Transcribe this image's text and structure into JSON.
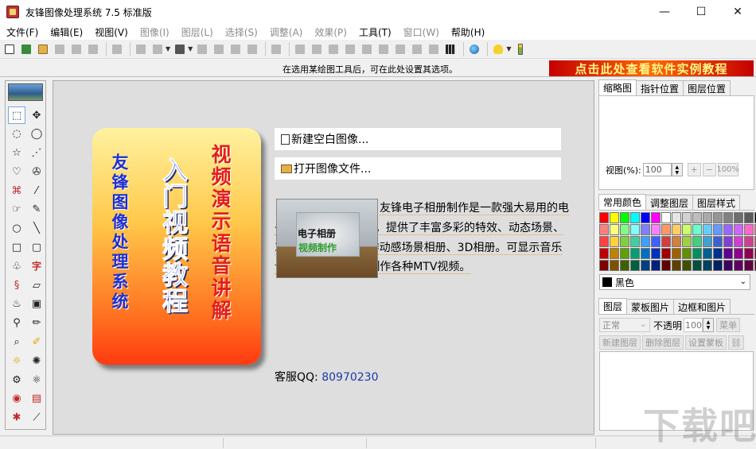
{
  "window": {
    "title": "友锋图像处理系统 7.5 标准版",
    "controls": {
      "minimize": "—",
      "maximize": "☐",
      "close": "✕"
    }
  },
  "menu": [
    {
      "label": "文件(F)",
      "enabled": true
    },
    {
      "label": "编辑(E)",
      "enabled": true
    },
    {
      "label": "视图(V)",
      "enabled": true
    },
    {
      "label": "图像(I)",
      "enabled": false
    },
    {
      "label": "图层(L)",
      "enabled": false
    },
    {
      "label": "选择(S)",
      "enabled": false
    },
    {
      "label": "调整(A)",
      "enabled": false
    },
    {
      "label": "效果(P)",
      "enabled": false
    },
    {
      "label": "工具(T)",
      "enabled": true
    },
    {
      "label": "窗口(W)",
      "enabled": false
    },
    {
      "label": "帮助(H)",
      "enabled": true
    }
  ],
  "toolbar": {
    "icons": [
      "new-file-icon",
      "scan-icon",
      "open-folder-icon",
      "save-icon",
      "save-as-icon",
      "batch-icon",
      "print-icon",
      "cut-icon",
      "copy-icon",
      "paste-icon",
      "transform-icon",
      "rotate-icon",
      "crop-icon",
      "effects-icon",
      "undo-icon",
      "filter-1-icon",
      "filter-2-icon",
      "filter-3-icon",
      "filter-4-icon",
      "filter-5-icon",
      "filter-6-icon",
      "filter-7-icon",
      "filter-8-icon",
      "frame-icon",
      "film-icon",
      "globe-icon",
      "help-icon",
      "battery-icon"
    ]
  },
  "options": {
    "hint": "在选用某绘图工具后，可在此处设置其选项。",
    "promo_banner": "点击此处查看软件实例教程"
  },
  "toolbox": {
    "tools": [
      "rect-select",
      "move",
      "ellipse-select",
      "rotate-select",
      "lasso",
      "polygon-lasso",
      "free-select",
      "magic-lasso",
      "node-select",
      "magic-wand",
      "clone",
      "brush",
      "circle",
      "line",
      "rectangle",
      "rounded-rect",
      "curve",
      "text",
      "spiral",
      "eraser",
      "fill",
      "gradient",
      "eyedropper",
      "pen",
      "zoom",
      "highlighter",
      "sun-light",
      "sun-dark",
      "transform",
      "gear",
      "red-eye",
      "frame",
      "effect-brush",
      "ruler"
    ],
    "text_tool_label": "字"
  },
  "welcome": {
    "card": {
      "col1": "友锋图像处理系统",
      "col2": "入门视频教程",
      "col3": "视频演示语音讲解"
    },
    "new_image": "新建空白图像...",
    "open_image": "打开图像文件...",
    "thumb_line1": "电子相册",
    "thumb_line2": "视频制作",
    "description": "友锋电子相册制作是一款强大易用的电子相册视频制作软件。提供了丰富多彩的特效、动态场景、3D场景等，轻松制作动感场景相册、3D相册。可显示音乐卡拉OK歌词，方便制作各种MTV视频。",
    "service_label": "客服QQ: ",
    "service_qq": "80970230"
  },
  "thumb_panel": {
    "tabs": [
      "缩略图",
      "指针位置",
      "图层位置"
    ],
    "zoom_label": "视图(%):",
    "zoom_value": "100",
    "zoom_in": "+",
    "zoom_out": "−",
    "zoom_100": "100%"
  },
  "color_panel": {
    "tabs": [
      "常用颜色",
      "调整图层",
      "图层样式"
    ],
    "selected_color_name": "黑色",
    "selected_color": "#000000",
    "swatches": [
      "#ff0000",
      "#ffff00",
      "#00ff00",
      "#00ffff",
      "#0000ff",
      "#ff00ff",
      "#ffffff",
      "#e6e6e6",
      "#d2d2d2",
      "#bebebe",
      "#aaaaaa",
      "#969696",
      "#828282",
      "#6e6e6e",
      "#5a5a5a",
      "#000000",
      "#ff8080",
      "#ffff80",
      "#80ff80",
      "#80ffff",
      "#8080ff",
      "#ff80ff",
      "#ff9966",
      "#ffcc66",
      "#ccff66",
      "#66ffcc",
      "#66ccff",
      "#6699ff",
      "#9966ff",
      "#cc66ff",
      "#ff66cc",
      "#ff6699",
      "#ff4040",
      "#ffd040",
      "#80d040",
      "#40d0a0",
      "#40a0ff",
      "#4060ff",
      "#d04040",
      "#d08040",
      "#a0d040",
      "#40d080",
      "#40a0d0",
      "#4060d0",
      "#8040d0",
      "#d040d0",
      "#d04090",
      "#d04060",
      "#c00000",
      "#c08000",
      "#60a000",
      "#00a070",
      "#0070c0",
      "#0030c0",
      "#a00000",
      "#a06000",
      "#609000",
      "#009060",
      "#006090",
      "#003090",
      "#600090",
      "#900090",
      "#900050",
      "#900030",
      "#800000",
      "#805000",
      "#406000",
      "#006040",
      "#004080",
      "#002080",
      "#600000",
      "#604000",
      "#405000",
      "#005040",
      "#004060",
      "#002060",
      "#400060",
      "#600060",
      "#600040",
      "#600020"
    ]
  },
  "layers_panel": {
    "tabs": [
      "图层",
      "蒙板图片",
      "边框和图片"
    ],
    "blend_mode": "正常",
    "opacity_label": "不透明",
    "opacity_value": "100",
    "menu_button": "菜单",
    "actions": [
      "新建图层",
      "删除图层",
      "设置蒙板"
    ]
  },
  "watermark": "下载吧"
}
